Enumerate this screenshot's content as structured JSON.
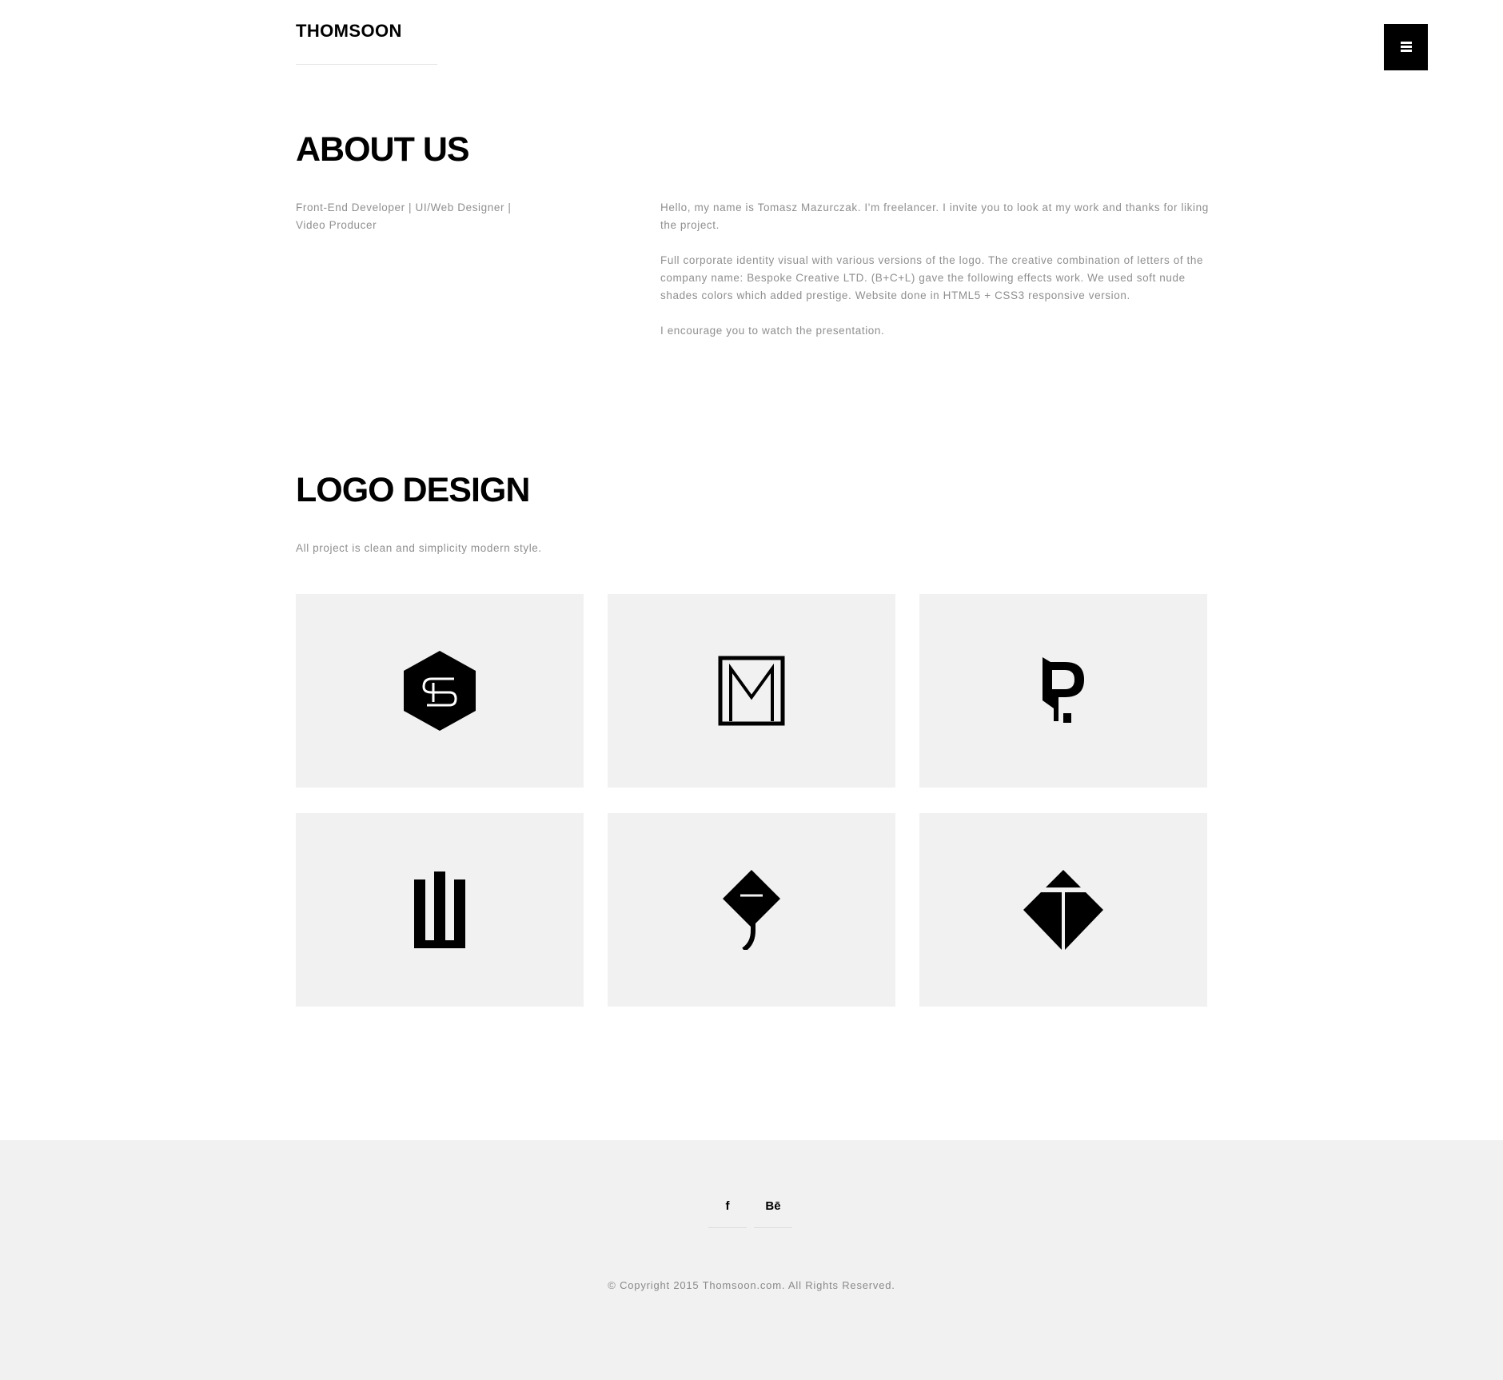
{
  "header": {
    "brand": "THOMSOON",
    "menu_icon": "hamburger-menu-icon"
  },
  "about": {
    "title": "ABOUT US",
    "role": "Front-End Developer | UI/Web Designer | Video Producer",
    "paragraphs": [
      "Hello, my name is Tomasz Mazurczak. I'm freelancer. I invite you to look at my work and thanks for liking the project.",
      "Full corporate identity visual with various versions of the logo. The creative combination of letters of the company name: Bespoke Creative LTD. (B+C+L) gave the following effects work. We used soft nude shades colors which added prestige. Website done in HTML5 + CSS3 responsive version.",
      "I encourage you to watch the presentation."
    ]
  },
  "logo_design": {
    "title": "LOGO DESIGN",
    "subtitle": "All project is clean and simplicity modern style.",
    "tiles": [
      {
        "icon": "hexagon-monogram-logo"
      },
      {
        "icon": "m-frame-logo"
      },
      {
        "icon": "dp-monogram-logo"
      },
      {
        "icon": "three-bars-logo"
      },
      {
        "icon": "diamond-j-logo"
      },
      {
        "icon": "diamond-arrow-logo"
      }
    ]
  },
  "footer": {
    "social": [
      {
        "icon": "facebook-icon",
        "glyph": "f"
      },
      {
        "icon": "behance-icon",
        "glyph": "Bē"
      }
    ],
    "copyright": "© Copyright 2015 Thomsoon.com. All Rights Reserved."
  },
  "colors": {
    "text": "#000000",
    "muted": "#8f8f8f",
    "tile_bg": "#f1f1f1",
    "footer_bg": "#f1f1f1"
  }
}
